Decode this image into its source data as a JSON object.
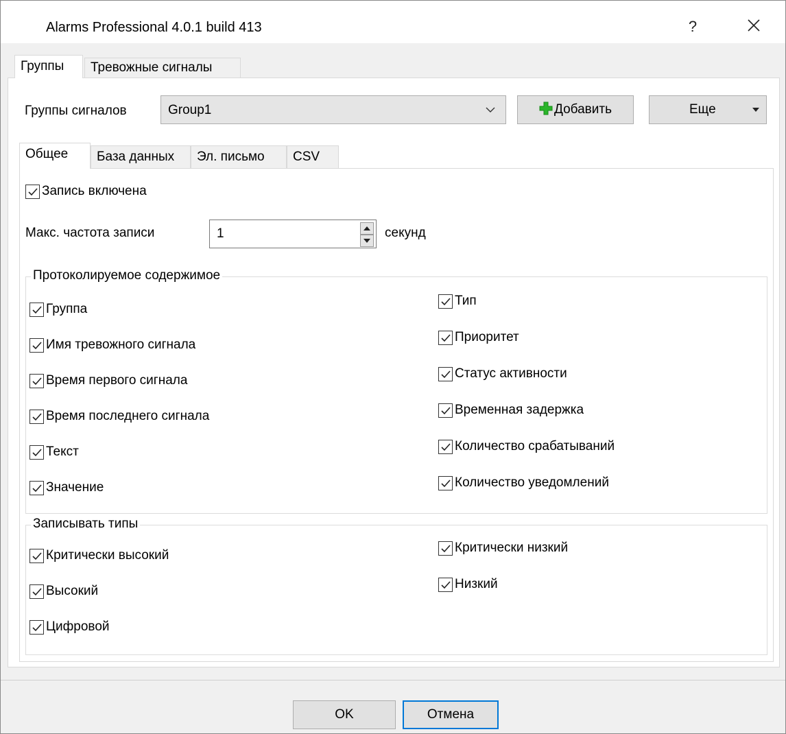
{
  "window": {
    "title": "Alarms Professional 4.0.1 build 413",
    "help_label": "?"
  },
  "main_tabs": [
    {
      "label": "Группы",
      "active": true
    },
    {
      "label": "Тревожные сигналы",
      "active": false
    }
  ],
  "groups_row": {
    "label": "Группы сигналов",
    "selected_group": "Group1",
    "add_button_label": "Добавить",
    "more_button_label": "Еще"
  },
  "sub_tabs": [
    {
      "label": "Общее",
      "active": true
    },
    {
      "label": "База данных",
      "active": false
    },
    {
      "label": "Эл. письмо",
      "active": false
    },
    {
      "label": "CSV",
      "active": false
    }
  ],
  "general": {
    "logging_enabled": {
      "label": "Запись включена",
      "checked": true
    },
    "max_rate": {
      "label": "Макс. частота записи",
      "value": "1",
      "unit": "секунд"
    }
  },
  "logged_content": {
    "title": "Протоколируемое содержимое",
    "left": [
      {
        "label": "Группа",
        "checked": true
      },
      {
        "label": "Имя тревожного сигнала",
        "checked": true
      },
      {
        "label": "Время первого сигнала",
        "checked": true
      },
      {
        "label": "Время последнего сигнала",
        "checked": true
      },
      {
        "label": "Текст",
        "checked": true
      },
      {
        "label": "Значение",
        "checked": true
      }
    ],
    "right": [
      {
        "label": "Тип",
        "checked": true
      },
      {
        "label": "Приоритет",
        "checked": true
      },
      {
        "label": "Статус активности",
        "checked": true
      },
      {
        "label": "Временная задержка",
        "checked": true
      },
      {
        "label": "Количество срабатываний",
        "checked": true
      },
      {
        "label": "Количество уведомлений",
        "checked": true
      }
    ]
  },
  "record_types": {
    "title": "Записывать типы",
    "left": [
      {
        "label": "Критически высокий",
        "checked": true
      },
      {
        "label": "Высокий",
        "checked": true
      },
      {
        "label": "Цифровой",
        "checked": true
      }
    ],
    "right": [
      {
        "label": "Критически низкий",
        "checked": true
      },
      {
        "label": "Низкий",
        "checked": true
      }
    ]
  },
  "footer": {
    "ok_label": "OK",
    "cancel_label": "Отмена"
  },
  "colors": {
    "accent": "#0078d7",
    "add_icon": "#2bb52b"
  }
}
